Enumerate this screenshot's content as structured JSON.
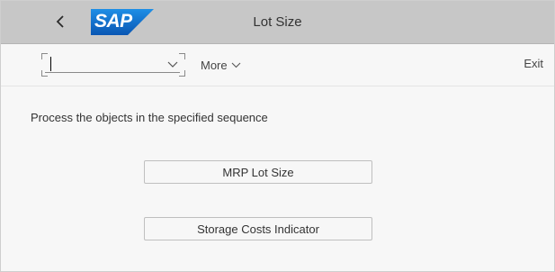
{
  "shell": {
    "title": "Lot Size",
    "logo_text": "SAP",
    "back_icon": "chevron-left-icon",
    "logo_color": "#0a6ed1"
  },
  "toolbar": {
    "command_field": {
      "value": "",
      "placeholder": ""
    },
    "more_label": "More",
    "exit_label": "Exit"
  },
  "main": {
    "instruction": "Process the objects in the specified sequence",
    "buttons": [
      {
        "label": "MRP Lot Size"
      },
      {
        "label": "Storage Costs Indicator"
      }
    ]
  }
}
